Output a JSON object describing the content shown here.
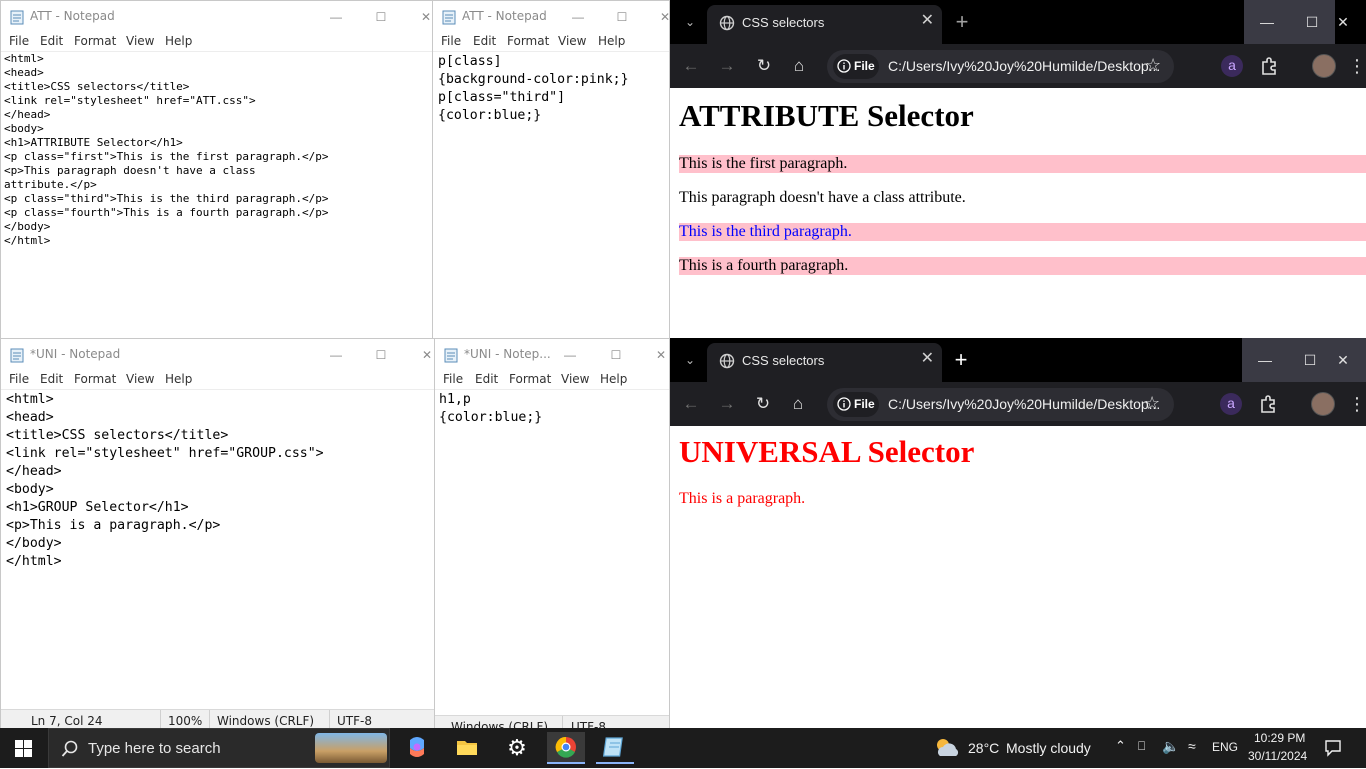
{
  "notepad_att_html": {
    "title": "ATT - Notepad",
    "menu": [
      "File",
      "Edit",
      "Format",
      "View",
      "Help"
    ],
    "content": "<html>\n<head>\n<title>CSS selectors</title>\n<link rel=\"stylesheet\" href=\"ATT.css\">\n</head>\n<body>\n<h1>ATTRIBUTE Selector</h1>\n<p class=\"first\">This is the first paragraph.</p>\n<p>This paragraph doesn't have a class\nattribute.</p>\n<p class=\"third\">This is the third paragraph.</p>\n<p class=\"fourth\">This is a fourth paragraph.</p>\n</body>\n</html>"
  },
  "notepad_att_css": {
    "title": "ATT - Notepad",
    "menu": [
      "File",
      "Edit",
      "Format",
      "View",
      "Help"
    ],
    "content": "p[class]\n{background-color:pink;}\np[class=\"third\"]\n{color:blue;}"
  },
  "notepad_uni_html": {
    "title": "*UNI - Notepad",
    "menu": [
      "File",
      "Edit",
      "Format",
      "View",
      "Help"
    ],
    "content": "<html>\n<head>\n<title>CSS selectors</title>\n<link rel=\"stylesheet\" href=\"GROUP.css\">\n</head>\n<body>\n<h1>GROUP Selector</h1>\n<p>This is a paragraph.</p>\n</body>\n</html>",
    "status": {
      "position": "Ln 7, Col 24",
      "zoom": "100%",
      "line_ending": "Windows (CRLF)",
      "encoding": "UTF-8"
    }
  },
  "notepad_uni_css": {
    "title": "*UNI - Notep...",
    "menu": [
      "File",
      "Edit",
      "Format",
      "View",
      "Help"
    ],
    "content": "h1,p\n{color:blue;}",
    "status": {
      "line_ending": "Windows (CRLF)",
      "encoding": "UTF-8"
    }
  },
  "chrome_top": {
    "tab_title": "CSS selectors",
    "url_chip": "File",
    "url": "C:/Users/Ivy%20Joy%20Humilde/Desktop...",
    "heading": "ATTRIBUTE Selector",
    "heading_color": "#000000",
    "highlight_color": "#ffc0cb",
    "paragraphs": [
      {
        "text": "This is the first paragraph.",
        "color": "#000000",
        "highlight": true
      },
      {
        "text": "This paragraph doesn't have a class attribute.",
        "color": "#000000",
        "highlight": false
      },
      {
        "text": "This is the third paragraph.",
        "color": "#0000ff",
        "highlight": true
      },
      {
        "text": "This is a fourth paragraph.",
        "color": "#000000",
        "highlight": true
      }
    ]
  },
  "chrome_bottom": {
    "tab_title": "CSS selectors",
    "url_chip": "File",
    "url": "C:/Users/Ivy%20Joy%20Humilde/Desktop...",
    "heading": "UNIVERSAL Selector",
    "heading_color": "#ff0000",
    "paragraphs": [
      {
        "text": "This is a paragraph.",
        "color": "#ff0000",
        "highlight": false
      }
    ]
  },
  "taskbar": {
    "search_placeholder": "Type here to search",
    "weather_temp": "28°C",
    "weather_desc": "Mostly cloudy",
    "language": "ENG",
    "time": "10:29 PM",
    "date": "30/11/2024"
  }
}
